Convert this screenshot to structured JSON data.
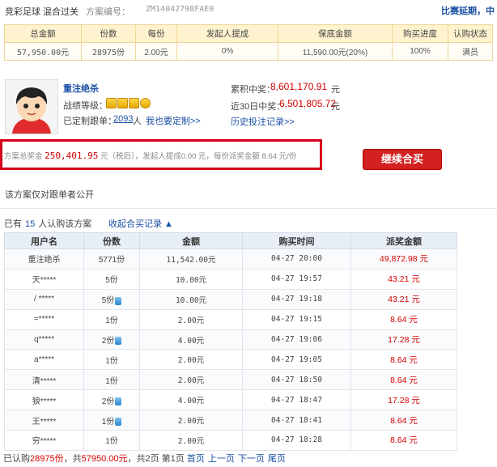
{
  "header": {
    "lottery": "竞彩足球",
    "play_type": "混合过关",
    "plan_no_label": "方案编号：",
    "plan_no": "ZM14042798FAE0",
    "right_link": "比赛延期，中"
  },
  "summary": {
    "headers": [
      "总金额",
      "份数",
      "每份",
      "发起人提成",
      "保底金额",
      "购买进度",
      "认购状态"
    ],
    "values": [
      "57,950.00元",
      "28975份",
      "2.00元",
      "0%",
      "11,590.00元(20%)",
      "100%",
      "满员"
    ]
  },
  "user": {
    "name": "重注绝杀",
    "level_label": "战绩等级：",
    "custom_label": "已定制跟单：",
    "custom_count": "2093",
    "custom_unit": "人",
    "custom_link": "我也要定制>>",
    "total_win_label": "累积中奖：",
    "total_win_value": "8,601,170.91",
    "total_win_unit": "元",
    "recent_win_label": "近30日中奖：",
    "recent_win_value": "6,501,805.72",
    "recent_win_unit": "元",
    "history_link": "历史投注记录>>"
  },
  "prize": {
    "label": "方案总奖金",
    "amount": "250,401.95",
    "rest": " 元（税后），发起人提成0.00 元，每份派奖金额 8.64 元/份",
    "buy_button": "继续合买"
  },
  "public_note": "该方案仅对跟单者公开",
  "buyers": {
    "prefix": "已有",
    "count": "15",
    "suffix": "人认购该方案",
    "collapse_link": "收起合买记录 ▲"
  },
  "records": {
    "headers": [
      "用户名",
      "份数",
      "金额",
      "购买时间",
      "派奖金额"
    ],
    "rows": [
      {
        "user": "重注绝杀",
        "shares": "5771份",
        "mobile": false,
        "amount": "11,542.00元",
        "time": "04-27 20:00",
        "prize": "49,872.98 元"
      },
      {
        "user": "天*****",
        "shares": "5份",
        "mobile": false,
        "amount": "10.00元",
        "time": "04-27 19:57",
        "prize": "43.21 元"
      },
      {
        "user": "/ *****",
        "shares": "5份",
        "mobile": true,
        "amount": "10.00元",
        "time": "04-27 19:18",
        "prize": "43.21 元"
      },
      {
        "user": "=*****",
        "shares": "1份",
        "mobile": false,
        "amount": "2.00元",
        "time": "04-27 19:15",
        "prize": "8.64 元"
      },
      {
        "user": "q*****",
        "shares": "2份",
        "mobile": true,
        "amount": "4.00元",
        "time": "04-27 19:06",
        "prize": "17.28 元"
      },
      {
        "user": "a*****",
        "shares": "1份",
        "mobile": false,
        "amount": "2.00元",
        "time": "04-27 19:05",
        "prize": "8.64 元"
      },
      {
        "user": "清*****",
        "shares": "1份",
        "mobile": false,
        "amount": "2.00元",
        "time": "04-27 18:50",
        "prize": "8.64 元"
      },
      {
        "user": "狼*****",
        "shares": "2份",
        "mobile": true,
        "amount": "4.00元",
        "time": "04-27 18:47",
        "prize": "17.28 元"
      },
      {
        "user": "王*****",
        "shares": "1份",
        "mobile": true,
        "amount": "2.00元",
        "time": "04-27 18:41",
        "prize": "8.64 元"
      },
      {
        "user": "穷*****",
        "shares": "1份",
        "mobile": false,
        "amount": "2.00元",
        "time": "04-27 18:28",
        "prize": "8.64 元"
      }
    ]
  },
  "pager": {
    "prefix": "已认购",
    "shares": "28975份",
    "mid": "，共",
    "total": "57950.00元",
    "pages": "，共2页 第1页",
    "first": "首页",
    "prev": "上一页",
    "next": "下一页",
    "last": "尾页"
  }
}
